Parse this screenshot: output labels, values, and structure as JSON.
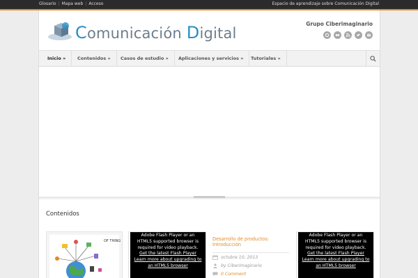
{
  "topbar": {
    "links": [
      "Glosario",
      "Mapa web",
      "Acceso"
    ],
    "tagline": "Espacio de aprendizaje sobre Comunicación Digital",
    "accent_color": "#e68a1f"
  },
  "header": {
    "logo_first_cap": "C",
    "logo_first_rest": "omunicación ",
    "logo_second_cap": "D",
    "logo_second_rest": "igital",
    "group_title": "Grupo Ciberimaginario",
    "social_icons": [
      "flickr-like-icon",
      "flickr-icon",
      "rss-icon",
      "twitter-icon",
      "email-icon"
    ]
  },
  "nav": {
    "items": [
      {
        "label": "Inicio »"
      },
      {
        "label": "Contenidos »"
      },
      {
        "label": "Casos de estudio »"
      },
      {
        "label": "Aplicaciones y servicios »"
      },
      {
        "label": "Tutoriales »"
      }
    ]
  },
  "content": {
    "section_title": "Contenidos",
    "flash_msg": {
      "line1": "Adobe Flash Player or an",
      "line2": "HTML5 supported browser is",
      "line3": "required for video playback.",
      "line4": "Get the latest Flash Player",
      "line5": "Learn more about upgrading to",
      "line6": "an HTML5 browser"
    },
    "post": {
      "title": "Desarrollo de productos: Introducción",
      "date": "octubre 10, 2013",
      "author": "by Ciberimaginario",
      "comments": "0 Comment"
    }
  },
  "colors": {
    "brand": "#2a8fc6",
    "accent": "#e08a2c"
  }
}
